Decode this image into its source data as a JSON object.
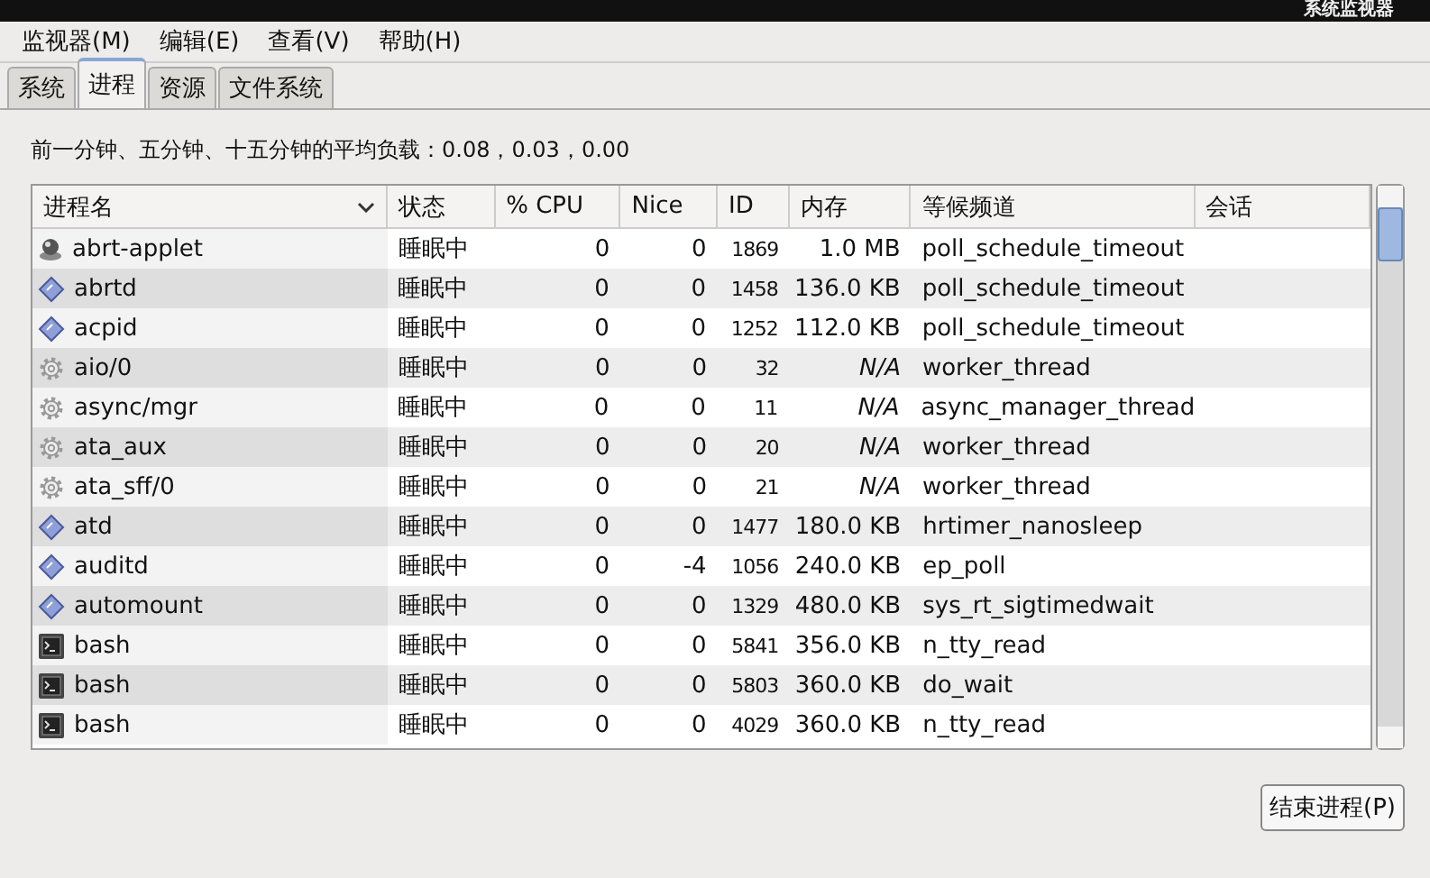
{
  "window": {
    "title": "系统监视器"
  },
  "menu": [
    "监视器(M)",
    "编辑(E)",
    "查看(V)",
    "帮助(H)"
  ],
  "tabs": [
    {
      "label": "系统",
      "selected": false
    },
    {
      "label": "进程",
      "selected": true
    },
    {
      "label": "资源",
      "selected": false
    },
    {
      "label": "文件系统",
      "selected": false
    }
  ],
  "load_average": "前一分钟、五分钟、十五分钟的平均负载：0.08，0.03，0.00",
  "table": {
    "columns": [
      {
        "label": "进程名",
        "sorted": true
      },
      {
        "label": "状态",
        "sorted": false
      },
      {
        "label": "% CPU",
        "sorted": false
      },
      {
        "label": "Nice",
        "sorted": false
      },
      {
        "label": "ID",
        "sorted": false
      },
      {
        "label": "内存",
        "sorted": false
      },
      {
        "label": "等候频道",
        "sorted": false
      },
      {
        "label": "会话",
        "sorted": false
      }
    ],
    "rows": [
      {
        "kind": "app",
        "name": "abrt-applet",
        "status": "睡眠中",
        "cpu": "0",
        "nice": "0",
        "id": "1869",
        "memory": "1.0 MB",
        "channel": "poll_schedule_timeout"
      },
      {
        "kind": "daemon",
        "name": "abrtd",
        "status": "睡眠中",
        "cpu": "0",
        "nice": "0",
        "id": "1458",
        "memory": "136.0 KB",
        "channel": "poll_schedule_timeout"
      },
      {
        "kind": "daemon",
        "name": "acpid",
        "status": "睡眠中",
        "cpu": "0",
        "nice": "0",
        "id": "1252",
        "memory": "112.0 KB",
        "channel": "poll_schedule_timeout"
      },
      {
        "kind": "kernel",
        "name": "aio/0",
        "status": "睡眠中",
        "cpu": "0",
        "nice": "0",
        "id": "32",
        "memory": "N/A",
        "channel": "worker_thread"
      },
      {
        "kind": "kernel",
        "name": "async/mgr",
        "status": "睡眠中",
        "cpu": "0",
        "nice": "0",
        "id": "11",
        "memory": "N/A",
        "channel": "async_manager_thread"
      },
      {
        "kind": "kernel",
        "name": "ata_aux",
        "status": "睡眠中",
        "cpu": "0",
        "nice": "0",
        "id": "20",
        "memory": "N/A",
        "channel": "worker_thread"
      },
      {
        "kind": "kernel",
        "name": "ata_sff/0",
        "status": "睡眠中",
        "cpu": "0",
        "nice": "0",
        "id": "21",
        "memory": "N/A",
        "channel": "worker_thread"
      },
      {
        "kind": "daemon",
        "name": "atd",
        "status": "睡眠中",
        "cpu": "0",
        "nice": "0",
        "id": "1477",
        "memory": "180.0 KB",
        "channel": "hrtimer_nanosleep"
      },
      {
        "kind": "daemon",
        "name": "auditd",
        "status": "睡眠中",
        "cpu": "0",
        "nice": "-4",
        "id": "1056",
        "memory": "240.0 KB",
        "channel": "ep_poll"
      },
      {
        "kind": "daemon",
        "name": "automount",
        "status": "睡眠中",
        "cpu": "0",
        "nice": "0",
        "id": "1329",
        "memory": "480.0 KB",
        "channel": "sys_rt_sigtimedwait"
      },
      {
        "kind": "terminal",
        "name": "bash",
        "status": "睡眠中",
        "cpu": "0",
        "nice": "0",
        "id": "5841",
        "memory": "356.0 KB",
        "channel": "n_tty_read"
      },
      {
        "kind": "terminal",
        "name": "bash",
        "status": "睡眠中",
        "cpu": "0",
        "nice": "0",
        "id": "5803",
        "memory": "360.0 KB",
        "channel": "do_wait"
      },
      {
        "kind": "terminal",
        "name": "bash",
        "status": "睡眠中",
        "cpu": "0",
        "nice": "0",
        "id": "4029",
        "memory": "360.0 KB",
        "channel": "n_tty_read"
      }
    ]
  },
  "end_process_button": "结束进程(P)"
}
